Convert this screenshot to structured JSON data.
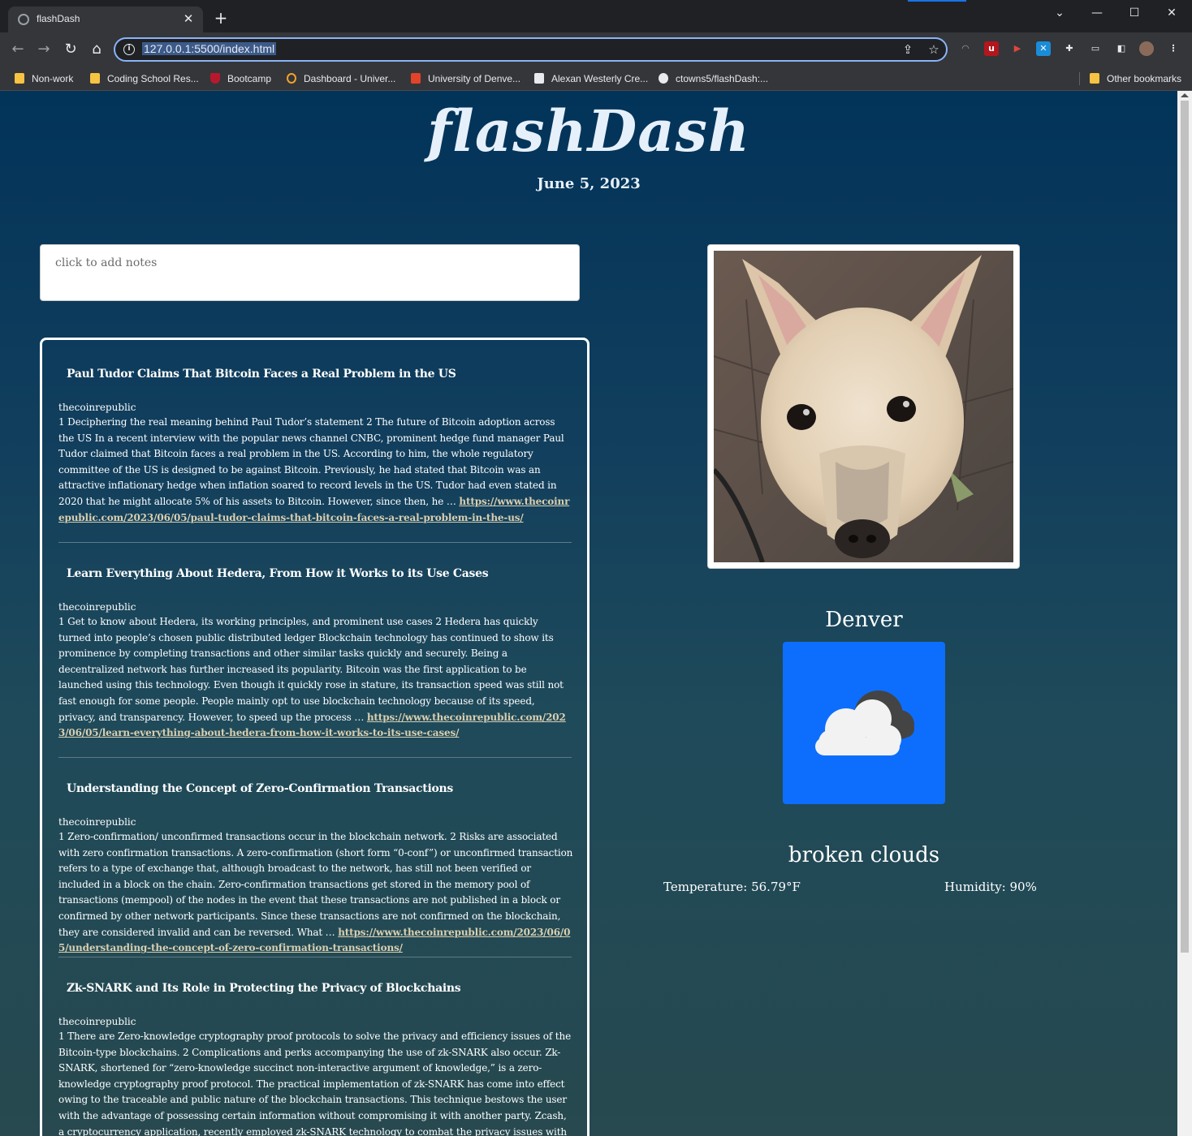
{
  "browser": {
    "tab_title": "flashDash",
    "tab_close": "✕",
    "new_tab": "+",
    "url": "127.0.0.1:5500/index.html",
    "bookmarks": [
      {
        "label": "Non-work",
        "icon": "folder-icon"
      },
      {
        "label": "Coding School Res...",
        "icon": "folder-icon"
      },
      {
        "label": "Bootcamp",
        "icon": "shield-icon"
      },
      {
        "label": "Dashboard - Univer...",
        "icon": "ed-icon"
      },
      {
        "label": "University of Denve...",
        "icon": "gitlab-icon"
      },
      {
        "label": "Alexan Westerly Cre...",
        "icon": "a-logo-icon"
      },
      {
        "label": "ctowns5/flashDash:...",
        "icon": "github-icon"
      }
    ],
    "other_bookmarks": "Other bookmarks"
  },
  "header": {
    "title": "flashDash",
    "date": "June 5, 2023"
  },
  "notes": {
    "placeholder": "click to add notes"
  },
  "news": [
    {
      "title": "Paul Tudor Claims That Bitcoin Faces a Real Problem in the US",
      "source": "thecoinrepublic",
      "body": "1 Deciphering the real meaning behind Paul Tudor’s statement 2 The future of Bitcoin adoption across the US In a recent interview with the popular news channel CNBC, prominent hedge fund manager Paul Tudor claimed that Bitcoin faces a real problem in the US. According to him, the whole regulatory committee of the US is designed to be against Bitcoin. Previously, he had stated that Bitcoin was an attractive inflationary hedge when inflation soared to record levels in the US. Tudor had even stated in 2020 that he might allocate 5% of his assets to Bitcoin. However, since then, he … ",
      "link": "https://www.thecoinrepublic.com/2023/06/05/paul-tudor-claims-that-bitcoin-faces-a-real-problem-in-the-us/"
    },
    {
      "title": "Learn Everything About Hedera, From How it Works to its Use Cases",
      "source": "thecoinrepublic",
      "body": "1 Get to know about Hedera, its working principles, and prominent use cases 2 Hedera has quickly turned into people’s chosen public distributed ledger Blockchain technology has continued to show its prominence by completing transactions and other similar tasks quickly and securely. Being a decentralized network has further increased its popularity. Bitcoin was the first application to be launched using this technology. Even though it quickly rose in stature, its transaction speed was still not fast enough for some people. People mainly opt to use blockchain technology because of its speed, privacy, and transparency. However, to speed up the process … ",
      "link": "https://www.thecoinrepublic.com/2023/06/05/learn-everything-about-hedera-from-how-it-works-to-its-use-cases/"
    },
    {
      "title": "Understanding the Concept of Zero-Confirmation Transactions",
      "source": "thecoinrepublic",
      "body": "1 Zero-confirmation/ unconfirmed transactions occur in the blockchain network. 2 Risks are associated with zero confirmation transactions. A zero-confirmation (short form “0-conf”) or unconfirmed transaction refers to a type of exchange that, although broadcast to the network, has still not been verified or included in a block on the chain. Zero-confirmation transactions get stored in the memory pool of transactions (mempool) of the nodes in the event that these transactions are not published in a block or confirmed by other network participants. Since these transactions are not confirmed on the blockchain, they are considered invalid and can be reversed.  What … ",
      "link": "https://www.thecoinrepublic.com/2023/06/05/understanding-the-concept-of-zero-confirmation-transactions/"
    },
    {
      "title": "Zk-SNARK and Its Role in Protecting the Privacy of Blockchains",
      "source": "thecoinrepublic",
      "body": "1 There are Zero-knowledge cryptography proof protocols to solve the privacy and efficiency issues of the Bitcoin-type blockchains. 2 Complications and perks accompanying the use of zk-SNARK also occur. Zk-SNARK, shortened for “zero-knowledge succinct non-interactive argument of knowledge,” is a zero-knowledge cryptography proof protocol. The practical implementation of zk-SNARK has come into effect owing to the traceable and public nature of the blockchain transactions. This technique bestows the user with the advantage of possessing certain information without compromising it with another party. Zcash, a cryptocurrency application, recently employed zk-SNARK technology to combat the privacy issues with Bitcoin-type blockchains.  Understanding zk-SNARK",
      "link": ""
    }
  ],
  "weather": {
    "city": "Denver",
    "description": "broken clouds",
    "temperature": "Temperature: 56.79°F",
    "humidity": "Humidity: 90%",
    "icon": "broken-clouds-icon",
    "tile_color": "#0d6efd"
  }
}
